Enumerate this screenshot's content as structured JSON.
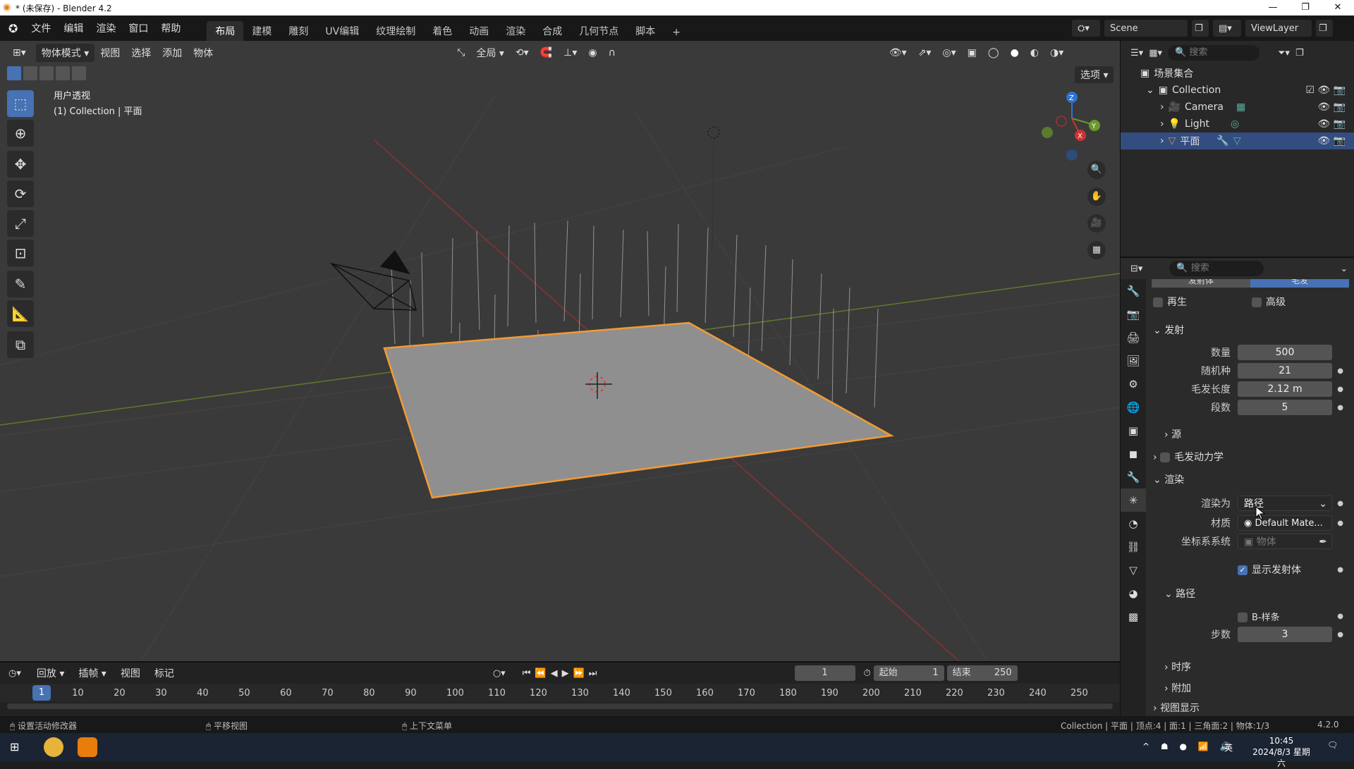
{
  "window": {
    "title": "* (未保存) - Blender 4.2"
  },
  "menu": [
    "文件",
    "编辑",
    "渲染",
    "窗口",
    "帮助"
  ],
  "workspaces": [
    "布局",
    "建模",
    "雕刻",
    "UV编辑",
    "纹理绘制",
    "着色",
    "动画",
    "渲染",
    "合成",
    "几何节点",
    "脚本"
  ],
  "scene": {
    "name": "Scene",
    "view_layer": "ViewLayer"
  },
  "viewport": {
    "mode": "物体模式",
    "header_menus": [
      "视图",
      "选择",
      "添加",
      "物体"
    ],
    "transform_orientation": "全局",
    "options_label": "选项",
    "overlay_title": "用户透视",
    "overlay_subtitle": "(1) Collection | 平面"
  },
  "outliner": {
    "search_placeholder": "搜索",
    "root": "场景集合",
    "collection": "Collection",
    "items": [
      "Camera",
      "Light",
      "平面"
    ]
  },
  "properties": {
    "search_placeholder": "搜索",
    "tabs": [
      "发射体",
      "毛发"
    ],
    "regen_label": "再生",
    "advanced_label": "高级",
    "emission": {
      "title": "发射",
      "count_label": "数量",
      "count": "500",
      "seed_label": "随机种",
      "seed": "21",
      "hair_length_label": "毛发长度",
      "hair_length": "2.12 m",
      "segments_label": "段数",
      "segments": "5",
      "source": "源"
    },
    "hair_dynamics": "毛发动力学",
    "render": {
      "title": "渲染",
      "render_as_label": "渲染为",
      "render_as": "路径",
      "material_label": "材质",
      "material": "Default Mate...",
      "coord_label": "坐标系系统",
      "coord_placeholder": "物体",
      "show_emitter": "显示发射体"
    },
    "path": {
      "title": "路径",
      "bspline": "B-样条",
      "steps_label": "步数",
      "steps": "3"
    },
    "timing": "时序",
    "extra": "附加",
    "viewport_display": "视图显示"
  },
  "timeline": {
    "menus": [
      "回放",
      "插帧",
      "视图",
      "标记"
    ],
    "current_frame": "1",
    "start_label": "起始",
    "start": "1",
    "end_label": "结束",
    "end": "250",
    "ticks": [
      "1",
      "10",
      "20",
      "30",
      "40",
      "50",
      "60",
      "70",
      "80",
      "90",
      "100",
      "110",
      "120",
      "130",
      "140",
      "150",
      "160",
      "170",
      "180",
      "190",
      "200",
      "210",
      "220",
      "230",
      "240",
      "250"
    ]
  },
  "status": {
    "left": "设置活动修改器",
    "mid": "平移视图",
    "right_menu": "上下文菜单",
    "stats": "Collection | 平面 | 顶点:4 | 面:1 | 三角面:2 | 物体:1/3",
    "version": "4.2.0"
  },
  "taskbar": {
    "time": "10:45",
    "date": "2024/8/3 星期六",
    "ime": "英"
  },
  "colors": {
    "accent": "#4772b3",
    "selection_orange": "#f29b34"
  }
}
